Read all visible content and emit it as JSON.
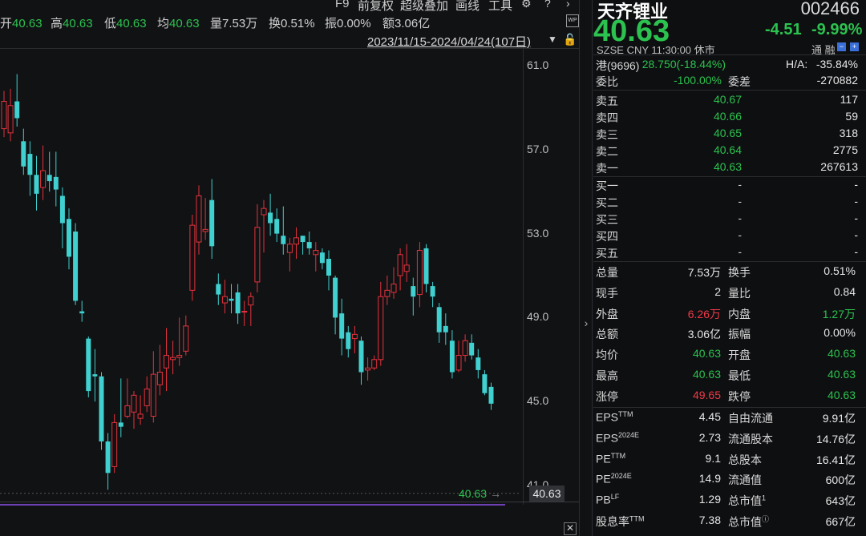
{
  "toolbar": {
    "stats": [
      {
        "label": "开",
        "value": "40.63"
      },
      {
        "label": "高",
        "value": "40.63"
      },
      {
        "label": "低",
        "value": "40.63"
      },
      {
        "label": "均",
        "value": "40.63"
      },
      {
        "label": "量",
        "value": "7.53万"
      },
      {
        "label": "换",
        "value": "0.51%"
      },
      {
        "label": "振",
        "value": "0.00%"
      },
      {
        "label": "额",
        "value": "3.06亿"
      }
    ],
    "buttons": [
      "F9",
      "前复权",
      "超级叠加",
      "画线",
      "工具"
    ],
    "date_range": "2023/11/15-2024/04/24(107日)"
  },
  "chart_data": {
    "type": "candlestick",
    "y_axis": [
      "61.0",
      "57.0",
      "53.0",
      "49.0",
      "45.0",
      "41.0"
    ],
    "ylim": [
      41,
      61
    ],
    "last_price": "40.63",
    "colors": {
      "up": "#e4323c",
      "down": "#3fd0cf",
      "text": "#2cc24f"
    },
    "candles": [
      [
        58.0,
        59.3,
        59.8,
        57.6
      ],
      [
        57.8,
        59.1,
        59.9,
        57.4
      ],
      [
        59.3,
        58.5,
        60.6,
        58.1
      ],
      [
        57.4,
        56.2,
        58.0,
        55.8
      ],
      [
        56.8,
        55.8,
        57.4,
        54.8
      ],
      [
        55.8,
        54.9,
        56.7,
        54.1
      ],
      [
        55.2,
        56.0,
        57.2,
        54.6
      ],
      [
        55.8,
        55.5,
        56.9,
        55.0
      ],
      [
        55.7,
        55.1,
        56.9,
        54.3
      ],
      [
        54.8,
        53.5,
        55.2,
        52.3
      ],
      [
        53.7,
        51.9,
        54.2,
        51.3
      ],
      [
        53.1,
        49.8,
        53.5,
        49.6
      ],
      [
        49.3,
        49.2,
        49.8,
        48.8
      ],
      [
        48.0,
        45.5,
        48.1,
        45.2
      ],
      [
        46.3,
        46.2,
        47.5,
        45.0
      ],
      [
        46.2,
        43.1,
        46.4,
        42.7
      ],
      [
        43.1,
        41.6,
        43.5,
        40.8
      ],
      [
        41.9,
        44.0,
        44.4,
        41.6
      ],
      [
        44.0,
        43.8,
        46.1,
        43.3
      ],
      [
        44.3,
        44.8,
        46.1,
        44.2
      ],
      [
        44.5,
        45.3,
        45.5,
        43.7
      ],
      [
        44.2,
        44.4,
        45.3,
        43.9
      ],
      [
        44.8,
        45.6,
        46.2,
        44.5
      ],
      [
        44.3,
        46.3,
        47.4,
        44.0
      ],
      [
        45.8,
        46.4,
        47.7,
        45.3
      ],
      [
        46.6,
        47.2,
        48.5,
        45.5
      ],
      [
        47.0,
        47.1,
        47.9,
        46.3
      ],
      [
        47.1,
        47.2,
        49.0,
        46.7
      ],
      [
        47.4,
        48.6,
        49.1,
        47.2
      ],
      [
        50.3,
        53.4,
        53.9,
        49.8
      ],
      [
        52.6,
        54.8,
        55.3,
        52.0
      ],
      [
        53.1,
        53.2,
        54.7,
        52.7
      ],
      [
        54.6,
        52.4,
        55.6,
        51.8
      ],
      [
        50.6,
        50.1,
        51.1,
        49.6
      ],
      [
        49.7,
        50.0,
        50.8,
        49.2
      ],
      [
        49.9,
        49.8,
        50.6,
        49.2
      ],
      [
        50.2,
        49.2,
        50.6,
        48.7
      ],
      [
        49.3,
        49.3,
        49.8,
        48.6
      ],
      [
        49.6,
        50.0,
        50.2,
        48.6
      ],
      [
        50.7,
        53.3,
        54.4,
        50.2
      ],
      [
        53.9,
        54.2,
        54.6,
        52.1
      ],
      [
        54.0,
        53.5,
        54.9,
        52.9
      ],
      [
        53.7,
        53.0,
        54.2,
        52.6
      ],
      [
        52.9,
        52.5,
        54.3,
        52.0
      ],
      [
        52.1,
        52.5,
        52.8,
        51.2
      ],
      [
        52.5,
        52.8,
        53.3,
        51.8
      ],
      [
        52.9,
        52.6,
        52.9,
        52.0
      ],
      [
        52.6,
        52.3,
        53.1,
        52.0
      ],
      [
        52.0,
        52.2,
        52.6,
        51.2
      ],
      [
        52.1,
        51.6,
        52.3,
        51.3
      ],
      [
        51.8,
        51.0,
        52.2,
        50.3
      ],
      [
        50.9,
        49.0,
        51.0,
        48.2
      ],
      [
        49.2,
        48.0,
        49.9,
        47.2
      ],
      [
        48.3,
        47.5,
        48.6,
        47.1
      ],
      [
        48.0,
        48.2,
        48.6,
        47.3
      ],
      [
        47.9,
        46.4,
        48.1,
        45.8
      ],
      [
        46.5,
        46.6,
        47.1,
        46.0
      ],
      [
        46.6,
        47.0,
        47.2,
        46.5
      ],
      [
        47.0,
        50.0,
        50.7,
        46.7
      ],
      [
        50.0,
        50.3,
        51.0,
        49.6
      ],
      [
        50.2,
        50.6,
        51.4,
        49.9
      ],
      [
        51.0,
        52.0,
        52.3,
        50.3
      ],
      [
        51.2,
        51.5,
        52.5,
        50.7
      ],
      [
        50.5,
        50.0,
        50.9,
        49.1
      ],
      [
        50.1,
        52.2,
        52.6,
        49.5
      ],
      [
        52.3,
        50.6,
        52.5,
        50.2
      ],
      [
        50.5,
        50.0,
        50.7,
        49.5
      ],
      [
        49.5,
        48.3,
        49.7,
        47.8
      ],
      [
        48.6,
        48.3,
        49.2,
        47.7
      ],
      [
        47.9,
        46.4,
        48.4,
        46.1
      ],
      [
        46.5,
        47.2,
        47.9,
        46.4
      ],
      [
        47.2,
        47.9,
        48.2,
        46.9
      ],
      [
        47.8,
        47.2,
        48.2,
        47.0
      ],
      [
        47.1,
        46.5,
        47.5,
        46.1
      ],
      [
        46.3,
        45.4,
        46.5,
        45.3
      ],
      [
        45.7,
        44.9,
        45.9,
        44.6
      ]
    ]
  },
  "quote": {
    "name": "天齐锂业",
    "code": "002466",
    "price": "40.63",
    "change": "-4.51",
    "change_pct": "-9.99%",
    "meta_left": "SZSE  CNY  11:30:00  休市",
    "meta_right": "通  融",
    "hk_label": "港(9696)",
    "hk_value": "28.750(-18.44%)",
    "ha_label": "H/A:",
    "ha_value": "-35.84%",
    "wb_label": "委比",
    "wb_value": "-100.00%",
    "wc_label": "委差",
    "wc_value": "-270882"
  },
  "order_book": {
    "asks": [
      {
        "label": "卖五",
        "price": "40.67",
        "vol": "117"
      },
      {
        "label": "卖四",
        "price": "40.66",
        "vol": "59"
      },
      {
        "label": "卖三",
        "price": "40.65",
        "vol": "318"
      },
      {
        "label": "卖二",
        "price": "40.64",
        "vol": "2775"
      },
      {
        "label": "卖一",
        "price": "40.63",
        "vol": "267613"
      }
    ],
    "bids": [
      {
        "label": "买一",
        "price": "-",
        "vol": "-"
      },
      {
        "label": "买二",
        "price": "-",
        "vol": "-"
      },
      {
        "label": "买三",
        "price": "-",
        "vol": "-"
      },
      {
        "label": "买四",
        "price": "-",
        "vol": "-"
      },
      {
        "label": "买五",
        "price": "-",
        "vol": "-"
      }
    ]
  },
  "stats": [
    {
      "l1": "总量",
      "v1": "7.53万",
      "c1": "white",
      "l2": "换手",
      "v2": "0.51%",
      "c2": "white"
    },
    {
      "l1": "现手",
      "v1": "2",
      "c1": "white",
      "l2": "量比",
      "v2": "0.84",
      "c2": "white"
    },
    {
      "l1": "外盘",
      "v1": "6.26万",
      "c1": "red",
      "l2": "内盘",
      "v2": "1.27万",
      "c2": "green"
    },
    {
      "l1": "总额",
      "v1": "3.06亿",
      "c1": "white",
      "l2": "振幅",
      "v2": "0.00%",
      "c2": "white"
    },
    {
      "l1": "均价",
      "v1": "40.63",
      "c1": "green",
      "l2": "开盘",
      "v2": "40.63",
      "c2": "green"
    },
    {
      "l1": "最高",
      "v1": "40.63",
      "c1": "green",
      "l2": "最低",
      "v2": "40.63",
      "c2": "green"
    },
    {
      "l1": "涨停",
      "v1": "49.65",
      "c1": "red",
      "l2": "跌停",
      "v2": "40.63",
      "c2": "green"
    }
  ],
  "fundamentals": [
    {
      "l1": "EPS",
      "s1": "TTM",
      "v1": "4.45",
      "l2": "自由流通",
      "s2": "",
      "v2": "9.91亿"
    },
    {
      "l1": "EPS",
      "s1": "2024E",
      "v1": "2.73",
      "l2": "流通股本",
      "s2": "",
      "v2": "14.76亿"
    },
    {
      "l1": "PE",
      "s1": "TTM",
      "v1": "9.1",
      "l2": "总股本",
      "s2": "",
      "v2": "16.41亿"
    },
    {
      "l1": "PE",
      "s1": "2024E",
      "v1": "14.9",
      "l2": "流通值",
      "s2": "",
      "v2": "600亿"
    },
    {
      "l1": "PB",
      "s1": "LF",
      "v1": "1.29",
      "l2": "总市值",
      "s2": "1",
      "v2": "643亿"
    },
    {
      "l1": "股息率",
      "s1": "TTM",
      "v1": "7.38",
      "l2": "总市值",
      "s2": "ⓘ",
      "v2": "667亿"
    }
  ]
}
